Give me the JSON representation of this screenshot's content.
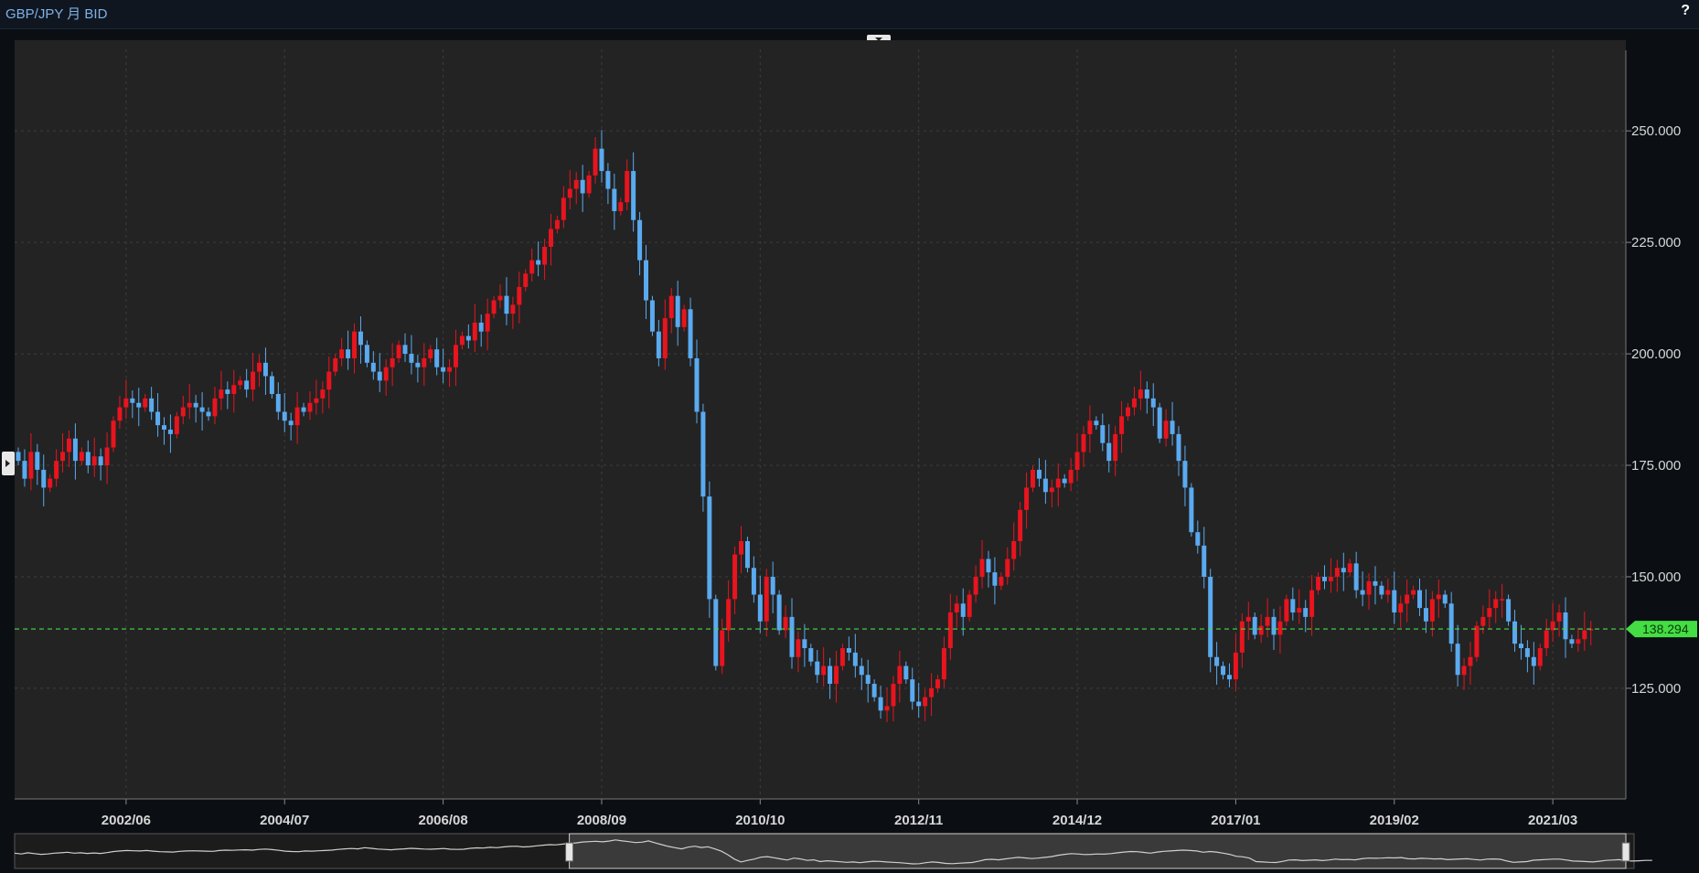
{
  "header": {
    "title": "GBP/JPY 月 BID",
    "help_label": "?"
  },
  "colors": {
    "up": "#e8141e",
    "down": "#5aaaf0",
    "background": "#232323",
    "grid": "#3d3d3d",
    "last_price": "#44dd44"
  },
  "chart_data": {
    "type": "candlestick",
    "title": "GBP/JPY 月 BID",
    "x_tick_labels": [
      "2002/06",
      "2004/07",
      "2006/08",
      "2008/09",
      "2010/10",
      "2012/11",
      "2014/12",
      "2017/01",
      "2019/02",
      "2021/03"
    ],
    "y_tick_labels": [
      "250.000",
      "225.000",
      "200.000",
      "175.000",
      "150.000",
      "125.000"
    ],
    "y_ticks": [
      250,
      225,
      200,
      175,
      150,
      125
    ],
    "ylim": [
      101,
      265
    ],
    "x_range": [
      "2001-01",
      "2021-05"
    ],
    "last_price": 138.294,
    "last_price_label": "138.294",
    "close_series": {
      "start": "2001-01",
      "interval": "month",
      "closes": [
        176,
        172,
        178,
        174,
        170,
        172,
        176,
        178,
        181,
        176,
        178,
        175,
        177,
        175,
        179,
        185,
        188,
        190,
        189,
        188,
        190,
        187,
        184,
        183,
        182,
        186,
        188,
        189,
        188,
        187,
        186,
        190,
        192,
        191,
        193,
        194,
        192,
        196,
        198,
        195,
        191,
        187,
        185,
        184,
        188,
        187,
        189,
        190,
        192,
        196,
        199,
        201,
        199,
        205,
        202,
        198,
        196,
        194,
        197,
        199,
        202,
        200,
        198,
        197,
        199,
        201,
        197,
        196,
        197,
        202,
        204,
        203,
        207,
        205,
        209,
        212,
        213,
        209,
        211,
        215,
        218,
        221,
        220,
        224,
        228,
        230,
        235,
        237,
        239,
        236,
        240,
        246,
        241,
        237,
        232,
        234,
        241,
        230,
        221,
        212,
        205,
        199,
        208,
        213,
        206,
        210,
        199,
        187,
        168,
        145,
        130,
        138,
        145,
        155,
        158,
        152,
        146,
        140,
        150,
        146,
        138,
        141,
        132,
        136,
        134,
        131,
        128,
        130,
        126,
        130,
        134,
        133,
        130,
        128,
        126,
        123,
        120,
        121,
        126,
        130,
        127,
        122,
        121,
        123,
        125,
        127,
        134,
        142,
        144,
        141,
        146,
        150,
        154,
        151,
        148,
        150,
        154,
        158,
        165,
        170,
        174,
        172,
        169,
        170,
        172,
        171,
        174,
        178,
        182,
        185,
        184,
        180,
        176,
        182,
        186,
        188,
        190,
        192,
        190,
        188,
        181,
        185,
        182,
        176,
        170,
        160,
        157,
        150,
        132,
        130,
        128,
        127,
        133,
        140,
        141,
        137,
        139,
        141,
        137,
        140,
        145,
        142,
        143,
        141,
        147,
        150,
        149,
        150,
        152,
        151,
        153,
        147,
        146,
        149,
        148,
        146,
        147,
        142,
        144,
        146,
        147,
        143,
        140,
        145,
        146,
        144,
        135,
        128,
        130,
        132,
        139,
        141,
        143,
        145,
        145,
        140,
        135,
        134,
        132,
        130,
        134,
        138,
        140,
        142,
        136,
        135,
        136,
        138,
        138.3
      ]
    },
    "navigator": {
      "visible_range": [
        "2008-01",
        "2021-05"
      ]
    }
  }
}
